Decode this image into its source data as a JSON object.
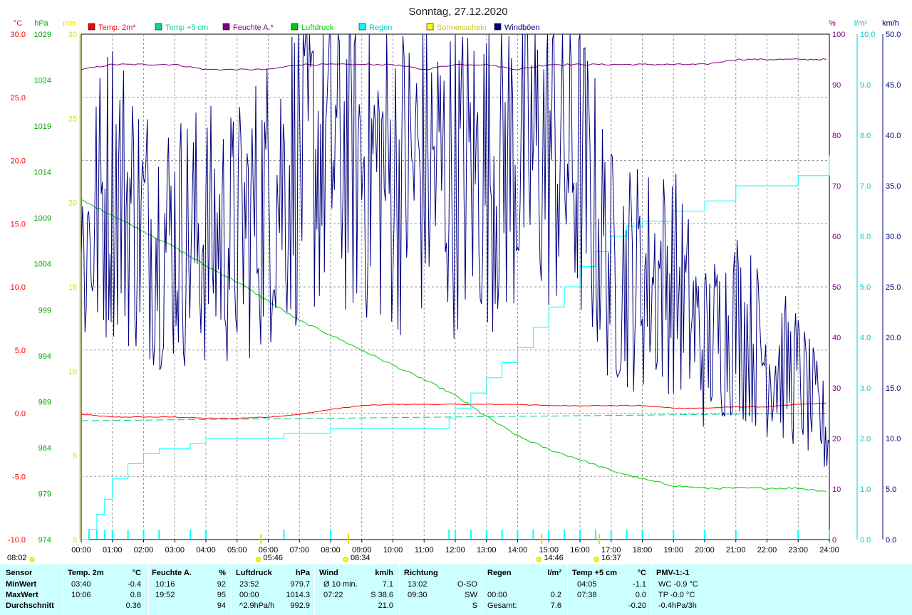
{
  "chart_data": {
    "type": "line",
    "title": "Sonntag, 27.12.2020",
    "x_ticks": [
      "00:00",
      "01:00",
      "02:00",
      "03:00",
      "04:00",
      "05:00",
      "06:00",
      "07:00",
      "08:00",
      "09:00",
      "10:00",
      "11:00",
      "12:00",
      "13:00",
      "14:00",
      "15:00",
      "16:00",
      "17:00",
      "18:00",
      "19:00",
      "20:00",
      "21:00",
      "22:00",
      "23:00",
      "24:00"
    ],
    "axes": {
      "temp": {
        "unit": "°C",
        "range": [
          -10,
          30
        ],
        "ticks": [
          "30.0",
          "25.0",
          "20.0",
          "15.0",
          "10.0",
          "5.0",
          "0.0",
          "-5.0",
          "-10.0"
        ],
        "color": "#ff0000"
      },
      "press": {
        "unit": "hPa",
        "range": [
          974,
          1034
        ],
        "ticks": [
          "1029",
          "1024",
          "1019",
          "1014",
          "1009",
          "1004",
          "999",
          "994",
          "989",
          "984",
          "979",
          "974"
        ],
        "color": "#00aa00"
      },
      "sun": {
        "unit": "min",
        "range": [
          0,
          30
        ],
        "ticks": [
          "30",
          "25",
          "20",
          "15",
          "10",
          "5",
          "0"
        ],
        "color": "#dddd00"
      },
      "hum": {
        "unit": "%",
        "range": [
          0,
          100
        ],
        "ticks": [
          "100",
          "90",
          "80",
          "70",
          "60",
          "50",
          "40",
          "30",
          "20",
          "10",
          "0"
        ],
        "color": "#800080"
      },
      "rain": {
        "unit": "l/m²",
        "range": [
          0,
          10
        ],
        "ticks": [
          "10.0",
          "9.0",
          "8.0",
          "7.0",
          "6.0",
          "5.0",
          "4.0",
          "3.0",
          "2.0",
          "1.0",
          "0.0"
        ],
        "color": "#00cccc"
      },
      "wind": {
        "unit": "km/h",
        "range": [
          0,
          50
        ],
        "ticks": [
          "50.0",
          "45.0",
          "40.0",
          "35.0",
          "30.0",
          "25.0",
          "20.0",
          "15.0",
          "10.0",
          "5.0",
          "0.0"
        ],
        "color": "#000080"
      }
    },
    "legend": [
      {
        "name": "Temp. 2m*",
        "color": "#ff0000"
      },
      {
        "name": "Temp +5 cm",
        "color": "#00dd88"
      },
      {
        "name": "Feuchte A.*",
        "color": "#800080"
      },
      {
        "name": "Luftdruck",
        "color": "#00cc00"
      },
      {
        "name": "Regen",
        "color": "#00ffff"
      },
      {
        "name": "Sonnenschein",
        "color": "#ffff00"
      },
      {
        "name": "Windböen",
        "color": "#000080"
      }
    ],
    "series": [
      {
        "name": "Temp. 2m*",
        "axis": "temp",
        "color": "#ff0000",
        "x": [
          0,
          1,
          2,
          3,
          4,
          5,
          6,
          7,
          8,
          9,
          10,
          11,
          12,
          13,
          14,
          15,
          16,
          17,
          18,
          19,
          20,
          21,
          22,
          23,
          24
        ],
        "y": [
          -0.1,
          -0.3,
          -0.3,
          -0.3,
          -0.4,
          -0.4,
          -0.3,
          -0.1,
          0.3,
          0.6,
          0.7,
          0.7,
          0.7,
          0.7,
          0.7,
          0.6,
          0.6,
          0.6,
          0.6,
          0.4,
          0.4,
          0.5,
          0.5,
          0.7,
          0.8
        ]
      },
      {
        "name": "Temp +5 cm",
        "axis": "temp",
        "color": "#00cc88",
        "dashed": true,
        "x": [
          0,
          24
        ],
        "y": [
          -0.6,
          0.0
        ]
      },
      {
        "name": "Feuchte A.*",
        "axis": "hum",
        "color": "#800080",
        "x": [
          0,
          1,
          2,
          3,
          4,
          5,
          6,
          7,
          8,
          9,
          10,
          11,
          12,
          13,
          14,
          15,
          16,
          17,
          18,
          19,
          20,
          21,
          22,
          23,
          24
        ],
        "y": [
          93,
          94,
          94,
          94,
          93,
          93,
          93,
          94,
          94,
          94,
          94,
          93,
          94,
          94,
          93,
          94,
          94,
          94,
          94,
          94,
          94,
          95,
          95,
          95,
          95
        ]
      },
      {
        "name": "Luftdruck",
        "axis": "press",
        "color": "#00cc00",
        "x": [
          0,
          1,
          2,
          3,
          4,
          5,
          6,
          7,
          8,
          9,
          10,
          11,
          12,
          13,
          14,
          15,
          16,
          17,
          18,
          19,
          20,
          21,
          22,
          23,
          24
        ],
        "y": [
          1014.3,
          1012.5,
          1010.6,
          1008.7,
          1006.5,
          1004.6,
          1002.3,
          1000.0,
          998.3,
          996.5,
          994.7,
          993.0,
          991.1,
          988.6,
          986.3,
          984.7,
          983.5,
          982.2,
          981.2,
          980.4,
          980.1,
          980.1,
          980.1,
          980.1,
          979.7
        ]
      },
      {
        "name": "Regen",
        "axis": "rain",
        "color": "#00ffff",
        "step": true,
        "x": [
          0,
          0.25,
          0.5,
          0.75,
          1.0,
          1.5,
          2.0,
          2.5,
          3.5,
          4.0,
          5.0,
          6.5,
          8.0,
          10.0,
          11.0,
          11.8,
          12.0,
          12.5,
          13.0,
          13.5,
          14.0,
          14.5,
          15.0,
          15.5,
          16.0,
          16.5,
          17.0,
          17.5,
          18.0,
          19.0,
          20.0,
          21.0,
          22.0,
          23.0,
          24.0
        ],
        "y": [
          0.0,
          0.2,
          0.5,
          0.8,
          1.2,
          1.5,
          1.7,
          1.8,
          1.9,
          2.0,
          2.0,
          2.1,
          2.2,
          2.2,
          2.2,
          2.4,
          2.6,
          2.9,
          3.2,
          3.5,
          3.8,
          4.2,
          4.6,
          5.0,
          5.4,
          5.7,
          6.0,
          6.2,
          6.3,
          6.5,
          6.7,
          7.0,
          7.0,
          7.2,
          7.6
        ]
      },
      {
        "name": "Windböen",
        "axis": "wind",
        "color": "#000080",
        "x": [
          0,
          1,
          2,
          3,
          4,
          5,
          6,
          7,
          8,
          9,
          10,
          11,
          12,
          13,
          14,
          15,
          16,
          17,
          18,
          19,
          20,
          21,
          22,
          23,
          24
        ],
        "y": [
          28,
          36,
          31,
          30,
          30,
          30,
          34,
          38,
          39,
          38,
          36,
          37,
          36,
          37,
          38,
          39,
          37,
          27,
          26,
          26,
          19,
          22,
          18,
          16,
          10
        ]
      }
    ],
    "sun_markers": [
      {
        "x": 5.77,
        "label": "05:46"
      },
      {
        "x": 8.57,
        "label": "08:34"
      },
      {
        "x": 14.77,
        "label": "14:46"
      },
      {
        "x": 16.62,
        "label": "16:37"
      }
    ],
    "first_time_label": "08:02"
  },
  "stats": {
    "headers": {
      "sensor": "Sensor",
      "temp": "Temp. 2m",
      "temp_u": "°C",
      "hum": "Feuchte A.",
      "hum_u": "%",
      "press": "Luftdruck",
      "press_u": "hPa",
      "wind": "Wind",
      "wind_u": "km/h",
      "dir": "Richtung",
      "rain": "Regen",
      "rain_u": "l/m²",
      "t5": "Temp +5 cm",
      "t5_u": "°C",
      "pmv": "PMV-1:-1"
    },
    "rows": [
      {
        "label": "MinWert",
        "temp_t": "03:40",
        "temp_v": "-0.4",
        "hum_t": "10:16",
        "hum_v": "92",
        "press_t": "23:52",
        "press_v": "979.7",
        "wind_t": "Ø 10 min.",
        "wind_v": "7.1",
        "dir_t": "13:02",
        "dir_v": "O-SO",
        "rain_t": "",
        "rain_v": "",
        "t5_t": "04:05",
        "t5_v": "-1.1",
        "pmv": "WC -0.9 °C"
      },
      {
        "label": "MaxWert",
        "temp_t": "10:06",
        "temp_v": "0.8",
        "hum_t": "19:52",
        "hum_v": "95",
        "press_t": "00:00",
        "press_v": "1014.3",
        "wind_t": "07:22",
        "wind_v": "S 38.6",
        "dir_t": "09:30",
        "dir_v": "SW",
        "rain_t": "00:00",
        "rain_v": "0.2",
        "t5_t": "07:38",
        "t5_v": "0.0",
        "pmv": "TP -0.0 °C"
      },
      {
        "label": "Durchschnitt",
        "temp_t": "",
        "temp_v": "0.36",
        "hum_t": "",
        "hum_v": "94",
        "press_t": "^2.9hPa/h",
        "press_v": "992.9",
        "wind_t": "",
        "wind_v": "21.0",
        "dir_t": "",
        "dir_v": "S",
        "rain_t": "Gesamt:",
        "rain_v": "7.6",
        "t5_t": "",
        "t5_v": "-0.20",
        "pmv": "-0.4hPa/3h"
      }
    ]
  }
}
